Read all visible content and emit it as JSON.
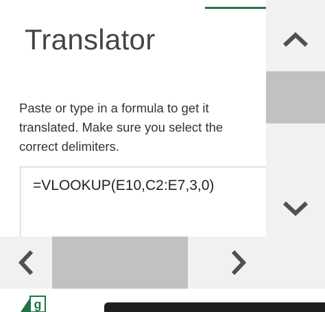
{
  "pane": {
    "title": "Translator",
    "instructions": "Paste or type in a formula to get it translated. Make sure you select the correct delimiters."
  },
  "formula": {
    "value": "=VLOOKUP(E10,C2:E7,3,0)"
  },
  "scrollbars": {
    "vertical": {
      "up_icon": "chevron-up-icon",
      "down_icon": "chevron-down-icon"
    },
    "horizontal": {
      "left_icon": "chevron-left-icon",
      "right_icon": "chevron-right-icon"
    }
  },
  "footer": {
    "logo_icon": "excel-logo-icon",
    "logo_letter": "g"
  },
  "colors": {
    "accent": "#217346",
    "scroll_track": "#f1f1f1",
    "scroll_thumb": "#c1c1c1",
    "arrow": "#505050"
  }
}
